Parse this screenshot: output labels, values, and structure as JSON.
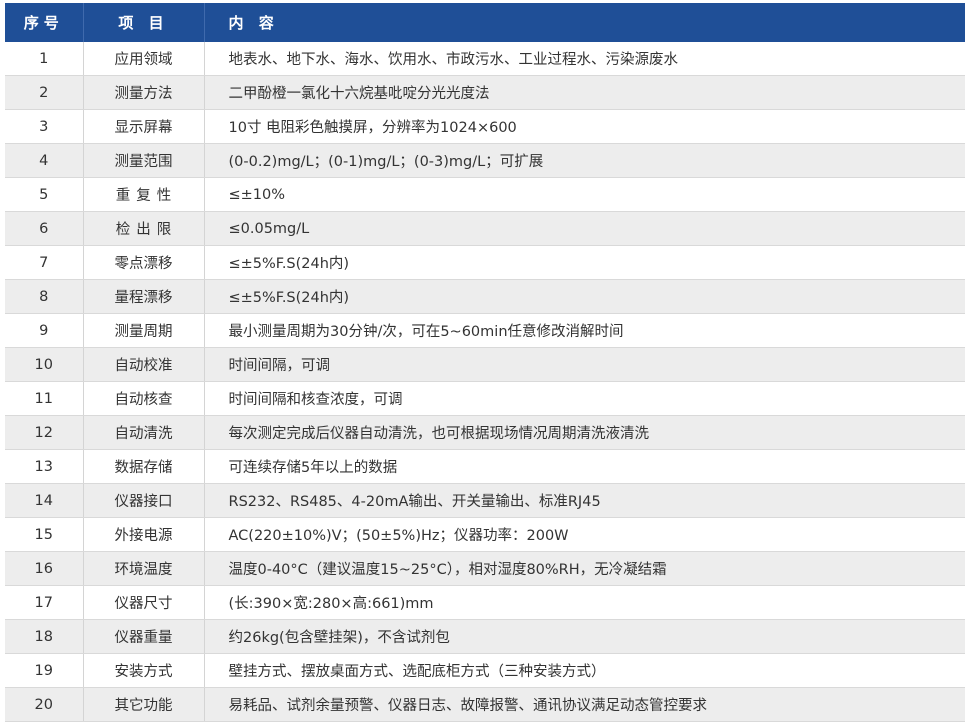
{
  "header": {
    "no": "序号",
    "item": "项 目",
    "content": "内 容"
  },
  "rows": [
    {
      "no": "1",
      "item": "应用领域",
      "content": "地表水、地下水、海水、饮用水、市政污水、工业过程水、污染源废水"
    },
    {
      "no": "2",
      "item": "测量方法",
      "content": "二甲酚橙一氯化十六烷基吡啶分光光度法"
    },
    {
      "no": "3",
      "item": "显示屏幕",
      "content": "10寸 电阻彩色触摸屏，分辨率为1024×600"
    },
    {
      "no": "4",
      "item": "测量范围",
      "content": "(0-0.2)mg/L；(0-1)mg/L；(0-3)mg/L；可扩展"
    },
    {
      "no": "5",
      "item": "重复性",
      "content": "≤±10%"
    },
    {
      "no": "6",
      "item": "检出限",
      "content": "≤0.05mg/L"
    },
    {
      "no": "7",
      "item": "零点漂移",
      "content": "≤±5%F.S(24h内)"
    },
    {
      "no": "8",
      "item": "量程漂移",
      "content": "≤±5%F.S(24h内)"
    },
    {
      "no": "9",
      "item": "测量周期",
      "content": "最小测量周期为30分钟/次，可在5~60min任意修改消解时间"
    },
    {
      "no": "10",
      "item": "自动校准",
      "content": "时间间隔，可调"
    },
    {
      "no": "11",
      "item": "自动核查",
      "content": "时间间隔和核查浓度，可调"
    },
    {
      "no": "12",
      "item": "自动清洗",
      "content": "每次测定完成后仪器自动清洗，也可根据现场情况周期清洗液清洗"
    },
    {
      "no": "13",
      "item": "数据存储",
      "content": "可连续存储5年以上的数据"
    },
    {
      "no": "14",
      "item": "仪器接口",
      "content": "RS232、RS485、4-20mA输出、开关量输出、标准RJ45"
    },
    {
      "no": "15",
      "item": "外接电源",
      "content": "AC(220±10%)V；(50±5%)Hz；仪器功率：200W"
    },
    {
      "no": "16",
      "item": "环境温度",
      "content": "温度0-40°C（建议温度15~25°C），相对湿度80%RH，无冷凝结霜"
    },
    {
      "no": "17",
      "item": "仪器尺寸",
      "content": "(长:390×宽:280×高:661)mm"
    },
    {
      "no": "18",
      "item": "仪器重量",
      "content": "约26kg(包含壁挂架)，不含试剂包"
    },
    {
      "no": "19",
      "item": "安装方式",
      "content": "壁挂方式、摆放桌面方式、选配底柜方式（三种安装方式）"
    },
    {
      "no": "20",
      "item": "其它功能",
      "content": "易耗品、试剂余量预警、仪器日志、故障报警、通讯协议满足动态管控要求"
    }
  ],
  "colors": {
    "header_bg": "#1f4f97",
    "header_text": "#ffffff",
    "stripe": "#ededed",
    "text": "#333333"
  }
}
